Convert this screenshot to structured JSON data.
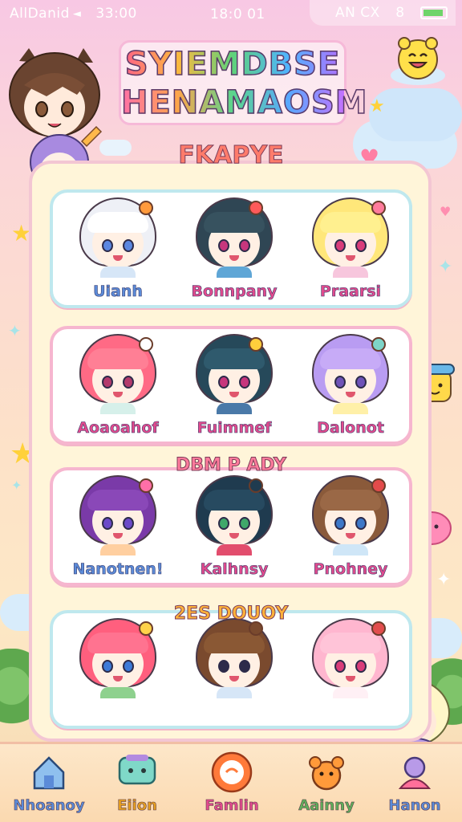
{
  "status_bar": {
    "carrier": "AllDanid",
    "signal_glyph": "◄",
    "left_time": "33:00",
    "center_time": "18:0 01",
    "right_text": "AN CX",
    "bt_glyph": "8"
  },
  "title": {
    "line1": "SYIEMDBSE",
    "line2": "HENAMAOSM"
  },
  "panel_heading": "FKAPYE",
  "sections": {
    "row3_label": "DBM P ADY",
    "row4_label": "2ES DOUOY"
  },
  "rows": [
    {
      "style": "blue",
      "cells": [
        {
          "name": "Uianh",
          "name_color": "#5b8bd8",
          "hair": "#eef0f6",
          "bangs": "#ffffff",
          "eye": "#5b87e0",
          "shirt": "#d6e6f7",
          "acc": "#ff9a3c"
        },
        {
          "name": "Bonnpany",
          "name_color": "#e34b8e",
          "hair": "#2f4654",
          "bangs": "#37525f",
          "eye": "#c7367d",
          "shirt": "#5fa6d6",
          "acc": "#ff5a5a"
        },
        {
          "name": "Praarsi",
          "name_color": "#e34b8e",
          "hair": "#ffe77a",
          "bangs": "#fff08f",
          "eye": "#d93d7a",
          "shirt": "#f7c6dd",
          "acc": "#ff7b9c"
        }
      ]
    },
    {
      "style": "pink",
      "cells": [
        {
          "name": "Aoaoahof",
          "name_color": "#e34b8e",
          "hair": "#ff6a85",
          "bangs": "#ff7f95",
          "eye": "#b33a6c",
          "shirt": "#d6f0ea",
          "acc": "#ffffff"
        },
        {
          "name": "Fuimmef",
          "name_color": "#e34b8e",
          "hair": "#26495a",
          "bangs": "#2f5a6d",
          "eye": "#c7367d",
          "shirt": "#4a79a8",
          "acc": "#ffcf3c"
        },
        {
          "name": "Dalonot",
          "name_color": "#e34b8e",
          "hair": "#b99cf2",
          "bangs": "#c7abf7",
          "eye": "#6e53b8",
          "shirt": "#fff0a8",
          "acc": "#7ed4c8"
        }
      ]
    },
    {
      "style": "pink",
      "cells": [
        {
          "name": "Nanotnen!",
          "name_color": "#5b8bd8",
          "hair": "#7a3aa8",
          "bangs": "#8a48b8",
          "eye": "#6b4ac9",
          "shirt": "#ffcfa0",
          "acc": "#ff6fa8"
        },
        {
          "name": "Kalhnsy",
          "name_color": "#e34b8e",
          "hair": "#1f3b4f",
          "bangs": "#274a60",
          "eye": "#3fa86a",
          "shirt": "#e24d6d",
          "acc": "#1f3b4f"
        },
        {
          "name": "Pnohney",
          "name_color": "#e34b8e",
          "hair": "#8a5a3a",
          "bangs": "#9a6846",
          "eye": "#3d78c8",
          "shirt": "#cfe6f7",
          "acc": "#e34b4b"
        }
      ]
    },
    {
      "style": "blue",
      "cells": [
        {
          "name": "",
          "name_color": "#e34b8e",
          "hair": "#ff5f7e",
          "bangs": "#ff7390",
          "eye": "#3d7ad8",
          "shirt": "#8ed18e",
          "acc": "#ffd24a"
        },
        {
          "name": "",
          "name_color": "#e34b8e",
          "hair": "#7a4a2e",
          "bangs": "#8a5834",
          "eye": "#2d2b4a",
          "shirt": "#d6e6f7",
          "acc": "#7a4a2e"
        },
        {
          "name": "",
          "name_color": "#e34b8e",
          "hair": "#ffb6cf",
          "bangs": "#ffc4d8",
          "eye": "#d93d7a",
          "shirt": "#fff0f5",
          "acc": "#e24d4d"
        }
      ]
    }
  ],
  "bottom_nav": [
    {
      "label": "Nhoanoy",
      "color": "#5b8bd8",
      "icon": "home-icon"
    },
    {
      "label": "Eiion",
      "color": "#e8a020",
      "icon": "chat-icon"
    },
    {
      "label": "Famlin",
      "color": "#e34b8e",
      "icon": "create-icon"
    },
    {
      "label": "Aainny",
      "color": "#5fb05a",
      "icon": "pet-icon"
    },
    {
      "label": "Hanon",
      "color": "#5b8bd8",
      "icon": "profile-icon"
    }
  ],
  "colors": {
    "accent_pink": "#ff6f9a",
    "card_blue_border": "#bfe8ee",
    "card_pink_border": "#f6b6cf",
    "panel_bg": "#fff5d9"
  }
}
